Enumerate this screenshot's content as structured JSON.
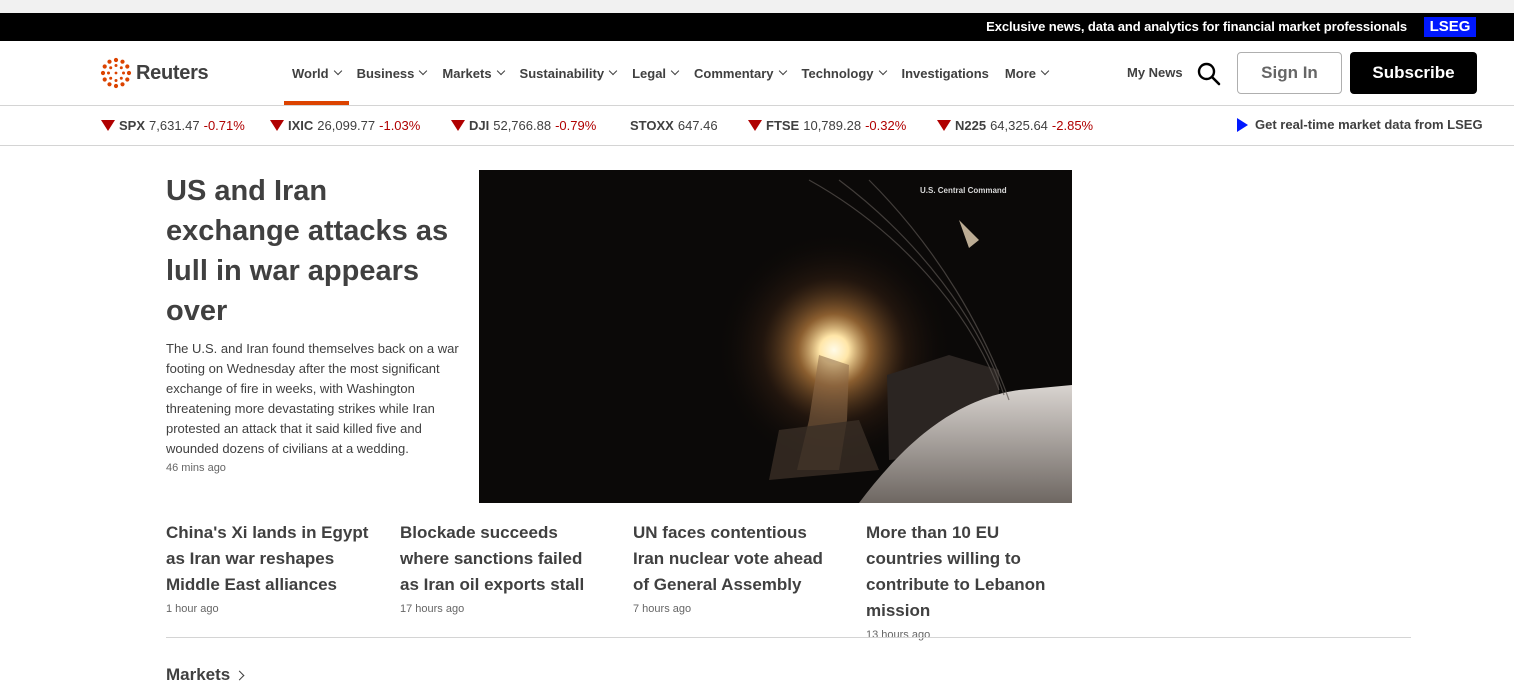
{
  "promo": {
    "text": "Exclusive news, data and analytics for financial market professionals",
    "badge": "LSEG"
  },
  "brand": {
    "name": "Reuters",
    "accent": "#dc4300"
  },
  "nav": {
    "items": [
      {
        "label": "World",
        "dropdown": true,
        "active": true
      },
      {
        "label": "Business",
        "dropdown": true
      },
      {
        "label": "Markets",
        "dropdown": true
      },
      {
        "label": "Sustainability",
        "dropdown": true
      },
      {
        "label": "Legal",
        "dropdown": true
      },
      {
        "label": "Commentary",
        "dropdown": true
      },
      {
        "label": "Technology",
        "dropdown": true
      },
      {
        "label": "Investigations",
        "dropdown": false
      },
      {
        "label": "More",
        "dropdown": true
      }
    ],
    "my_news": "My News",
    "search_icon": "search-icon",
    "sign_in": "Sign In",
    "subscribe": "Subscribe"
  },
  "ticker": {
    "items": [
      {
        "symbol": "SPX",
        "value": "7,631.47",
        "change": "-0.71%",
        "direction": "down"
      },
      {
        "symbol": "IXIC",
        "value": "26,099.77",
        "change": "-1.03%",
        "direction": "down"
      },
      {
        "symbol": "DJI",
        "value": "52,766.88",
        "change": "-0.79%",
        "direction": "down"
      },
      {
        "symbol": "STOXX",
        "value": "647.46",
        "change": "",
        "direction": "none"
      },
      {
        "symbol": "FTSE",
        "value": "10,789.28",
        "change": "-0.32%",
        "direction": "down"
      },
      {
        "symbol": "N225",
        "value": "64,325.64",
        "change": "-2.85%",
        "direction": "down"
      }
    ],
    "down_color": "#b00000",
    "lseg_link": "Get real-time market data from LSEG"
  },
  "lead": {
    "headline": "US and Iran exchange attacks as lull in war appears over",
    "summary": "The U.S. and Iran found themselves back on a war footing on Wednesday after the most significant exchange of fire in weeks, with Washington threatening more devastating strikes while Iran protested an attack that it said killed five and wounded dozens of civilians at a wedding.",
    "time": "46 mins ago",
    "image_credit": "U.S. Central Command"
  },
  "stories": [
    {
      "title": "China's Xi lands in Egypt as Iran war reshapes Middle East alliances",
      "time": "1 hour ago"
    },
    {
      "title": "Blockade succeeds where sanctions failed as Iran oil exports stall",
      "time": "17 hours ago"
    },
    {
      "title": "UN faces contentious Iran nuclear vote ahead of General Assembly",
      "time": "7 hours ago"
    },
    {
      "title": "More than 10 EU countries willing to contribute to Lebanon mission",
      "time": "13 hours ago"
    }
  ],
  "section": {
    "markets_heading": "Markets"
  }
}
